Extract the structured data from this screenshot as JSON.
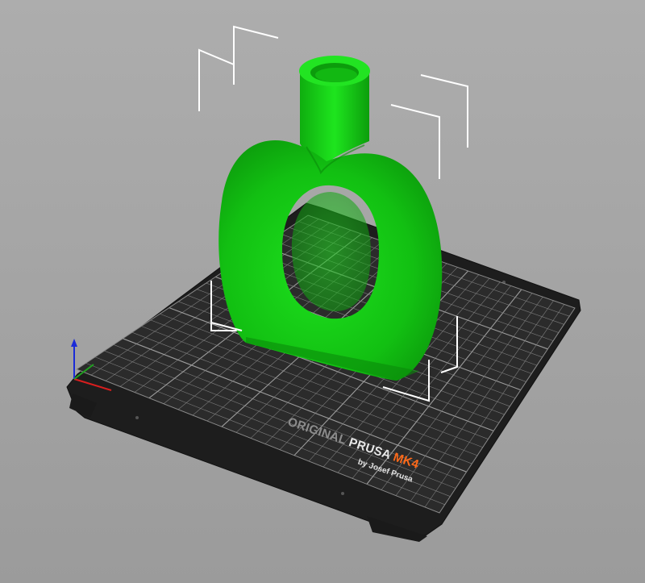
{
  "bed": {
    "brand_line": {
      "part1": "ORIGINAL ",
      "part2": "PRUSA ",
      "part3": "MK4"
    },
    "subline": "by Josef Prusa",
    "colors": {
      "sheet": "#2c2c2c",
      "sheet_edge": "#1a1a1a",
      "grid": "#7c7c7c",
      "grid_major": "#9c9c9c",
      "accent": "#ff6a1a"
    }
  },
  "model": {
    "color": "#10c210"
  },
  "axes": {
    "x_color": "#d81e1e",
    "y_color": "#1fa21f",
    "z_color": "#1a2bd8"
  },
  "background_color": "#a6a6a6"
}
